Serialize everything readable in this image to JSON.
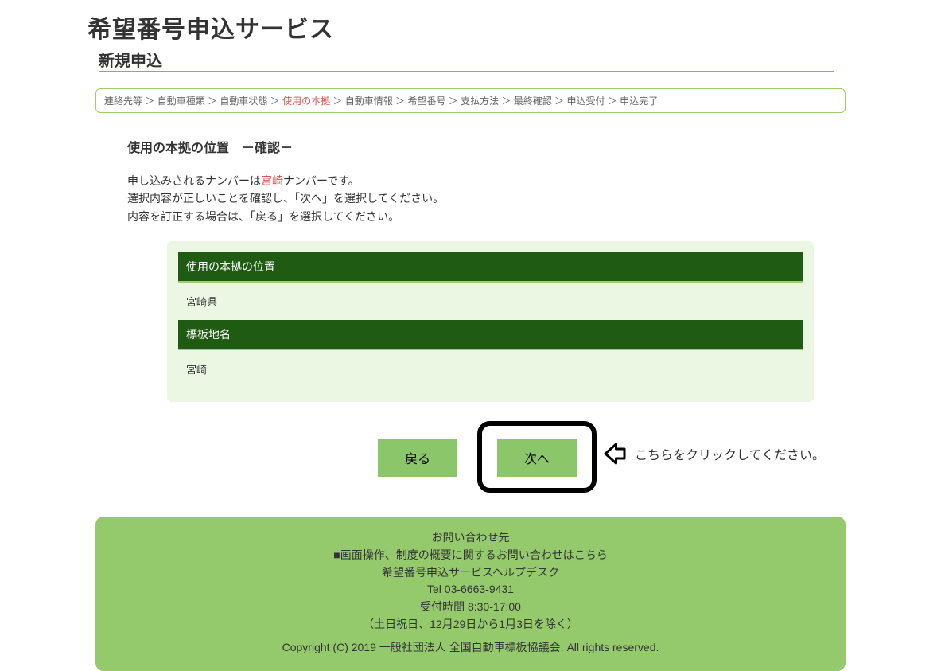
{
  "header": {
    "title": "希望番号申込サービス",
    "subtitle": "新規申込"
  },
  "breadcrumb": {
    "items": [
      "連絡先等",
      "自動車種類",
      "自動車状態",
      "使用の本拠",
      "自動車情報",
      "希望番号",
      "支払方法",
      "最終確認",
      "申込受付",
      "申込完了"
    ],
    "current_index": 3,
    "separator": " ＞ "
  },
  "section": {
    "title": "使用の本拠の位置　－確認－",
    "instruction_pre": "申し込みされるナンバーは",
    "instruction_highlight": "宮崎",
    "instruction_post": "ナンバーです。",
    "instruction_line2": "選択内容が正しいことを確認し、「次へ」を選択してください。",
    "instruction_line3": "内容を訂正する場合は、「戻る」を選択してください。"
  },
  "confirm": {
    "row1_header": "使用の本拠の位置",
    "row1_value": "宮崎県",
    "row2_header": "標板地名",
    "row2_value": "宮崎"
  },
  "buttons": {
    "back": "戻る",
    "next": "次へ"
  },
  "callout": {
    "text": "こちらをクリックしてください。"
  },
  "footer": {
    "contact_title": "お問い合わせ先",
    "line1": "■画面操作、制度の概要に関するお問い合わせはこちら",
    "line2": "希望番号申込サービスヘルプデスク",
    "tel": "Tel 03-6663-9431",
    "hours": "受付時間 8:30-17:00",
    "closed": "（土日祝日、12月29日から1月3日を除く）",
    "copyright": "Copyright (C) 2019 一般社団法人 全国自動車標板協議会. All rights reserved."
  }
}
